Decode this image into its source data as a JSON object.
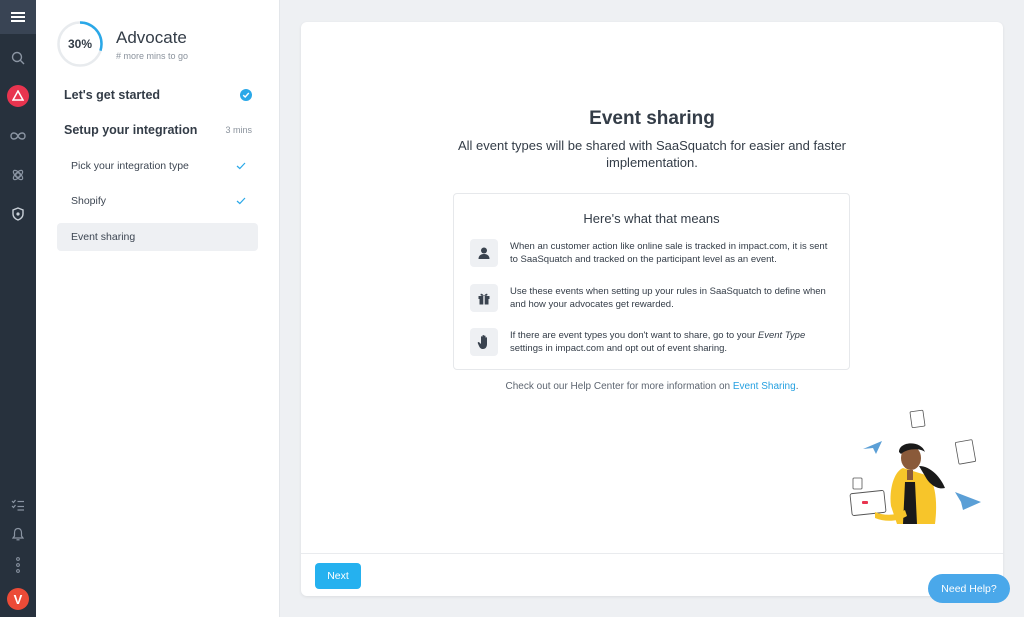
{
  "rail": {
    "avatar_letter": "V",
    "icons": [
      "menu-icon",
      "search-icon",
      "brand-icon",
      "infinity-icon",
      "integrations-icon",
      "shield-icon",
      "checklist-icon",
      "bell-icon",
      "more-icon"
    ]
  },
  "onboarding": {
    "progress_label": "30%",
    "progress_fraction": 0.3,
    "title": "Advocate",
    "subtitle": "# more mins to go",
    "steps": [
      {
        "label": "Let's get started",
        "time": "",
        "status": "done"
      },
      {
        "label": "Setup your integration",
        "time": "3 mins",
        "status": "in-progress"
      }
    ],
    "substeps": [
      {
        "label": "Pick your integration type",
        "done": true
      },
      {
        "label": "Shopify",
        "done": true
      },
      {
        "label": "Event sharing",
        "done": false,
        "active": true
      }
    ]
  },
  "main": {
    "title": "Event sharing",
    "subtitle": "All event types will be shared with SaaSquatch for easier and faster implementation.",
    "box_title": "Here's what that means",
    "items": [
      {
        "icon": "user-icon",
        "text": "When an customer action like online sale is tracked in impact.com, it is sent to SaaSquatch and tracked on the participant level as an event."
      },
      {
        "icon": "gift-icon",
        "text": "Use these events when setting up your rules in SaaSquatch to define when and how your advocates get rewarded."
      },
      {
        "icon": "hand-icon",
        "text_before": "If there are event types you don't want to share, go to your ",
        "text_em": "Event Type",
        "text_after": " settings in impact.com and opt out of event sharing."
      }
    ],
    "help_text": "Check out our Help Center for more information on ",
    "help_link": "Event Sharing",
    "help_end": ".",
    "next_label": "Next"
  },
  "need_help_label": "Need Help?",
  "colors": {
    "accent": "#25b1ef",
    "rail": "#27313d",
    "brand": "#e8344f",
    "avatar": "#ec4b37"
  }
}
